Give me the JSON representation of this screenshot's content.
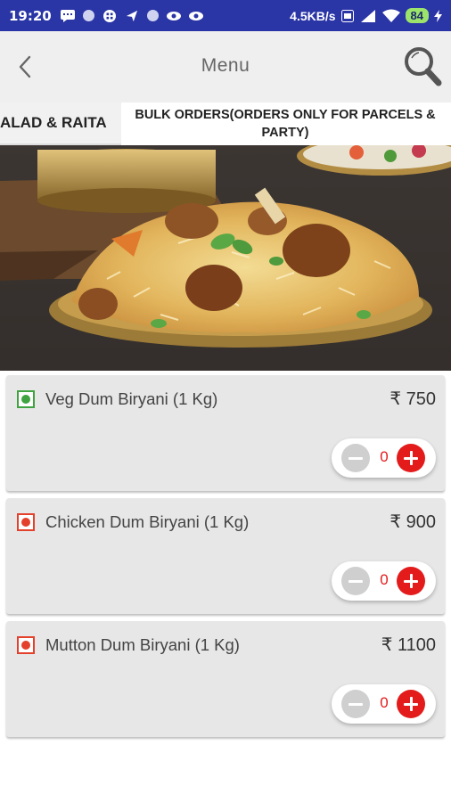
{
  "status_bar": {
    "time": "19:20",
    "network_speed": "4.5KB/s",
    "battery": "84"
  },
  "app_bar": {
    "title": "Menu",
    "back_icon": "chevron-left-icon",
    "search_icon": "search-icon"
  },
  "tabs": [
    {
      "label": "ALAD & RAITA"
    },
    {
      "label": "BULK ORDERS(ORDERS ONLY FOR PARCELS & PARTY)"
    }
  ],
  "hero": {
    "image": "biryani-platter-photo"
  },
  "items": [
    {
      "name": "Veg Dum Biryani (1 Kg)",
      "price": "₹ 750",
      "type": "veg",
      "type_color": "#3fa33f",
      "quantity": "0"
    },
    {
      "name": "Chicken Dum Biryani (1 Kg)",
      "price": "₹ 900",
      "type": "non-veg",
      "type_color": "#e3412b",
      "quantity": "0"
    },
    {
      "name": "Mutton Dum Biryani (1 Kg)",
      "price": "₹ 1100",
      "type": "non-veg",
      "type_color": "#e3412b",
      "quantity": "0"
    }
  ],
  "colors": {
    "status_bar": "#2a35a6",
    "accent": "#e31b1b"
  }
}
